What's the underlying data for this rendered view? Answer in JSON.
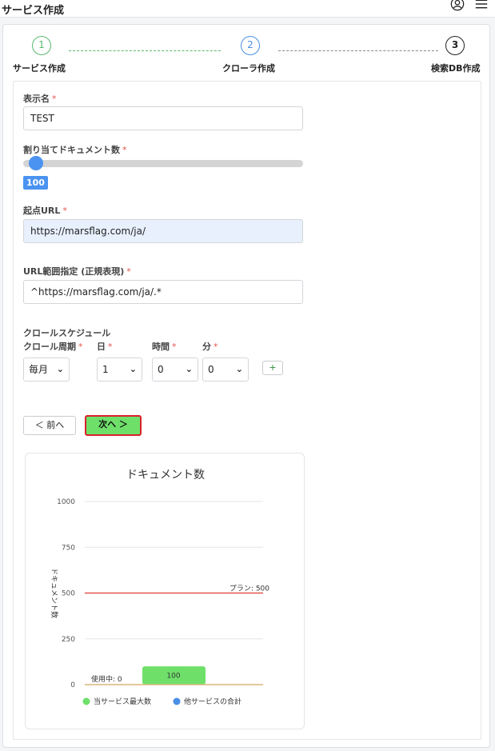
{
  "header": {
    "title": "サービス作成",
    "user_icon": "user-icon",
    "menu_icon": "menu-icon"
  },
  "stepper": {
    "steps": [
      {
        "number": "1",
        "label": "サービス作成"
      },
      {
        "number": "2",
        "label": "クローラ作成"
      },
      {
        "number": "3",
        "label": "検索DB作成"
      }
    ]
  },
  "form": {
    "display_name": {
      "label": "表示名",
      "required": "*",
      "value": "TEST"
    },
    "doc_count": {
      "label": "割り当てドキュメント数",
      "required": "*",
      "value": "100",
      "fraction": 0.02
    },
    "start_url": {
      "label": "起点URL",
      "required": "*",
      "value": "https://marsflag.com/ja/"
    },
    "url_range": {
      "label": "URL範囲指定 (正規表現)",
      "required": "*",
      "value": "^https://marsflag.com/ja/.*"
    },
    "schedule": {
      "title": "クロールスケジュール",
      "cycle": {
        "label": "クロール周期",
        "required": "*",
        "value": "毎月"
      },
      "day": {
        "label": "日",
        "required": "*",
        "value": "1"
      },
      "hour": {
        "label": "時間",
        "required": "*",
        "value": "0"
      },
      "minute": {
        "label": "分",
        "required": "*",
        "value": "0"
      },
      "add_label": "+"
    },
    "prev_button": "＜ 前へ",
    "next_button": "次へ ＞"
  },
  "chart_data": {
    "type": "bar",
    "title": "ドキュメント数",
    "ylabel": "ドキュメント数",
    "ylim": [
      0,
      1000
    ],
    "yticks": [
      "0",
      "250",
      "500",
      "750",
      "1000"
    ],
    "plan_line": {
      "value": 500,
      "label": "プラン: 500"
    },
    "used_label": "使用中: 0",
    "bars": [
      {
        "value": 100,
        "label": "100"
      }
    ],
    "legend": [
      {
        "name": "当サービス最大数",
        "color": "#6ee06a"
      },
      {
        "name": "他サービスの合計",
        "color": "#4a8ee6"
      }
    ],
    "colors": {
      "bar": "#6ee06a",
      "plan": "#e2554f",
      "baseline": "#d9b67a"
    }
  }
}
